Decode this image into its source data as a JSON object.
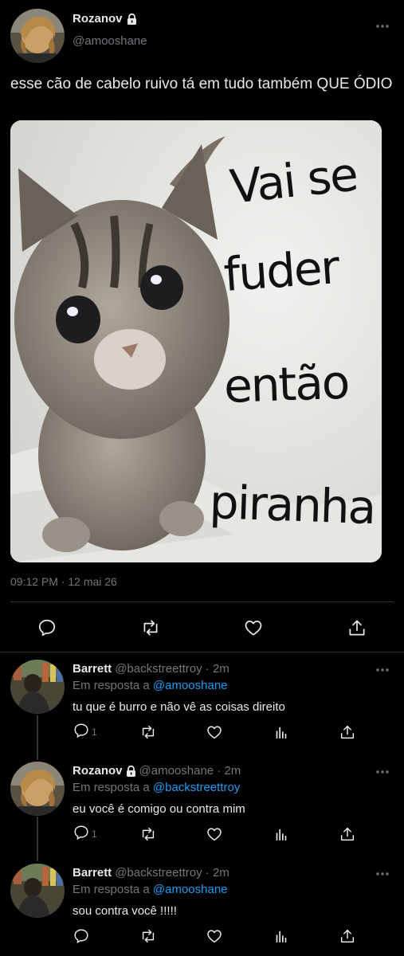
{
  "main_tweet": {
    "display_name": "Rozanov",
    "handle": "@amooshane",
    "text": "esse cão de cabelo ruivo tá em tudo também QUE ÓDIO",
    "image": {
      "meme_lines": [
        "Vai se",
        "fuder",
        "então",
        "piranha"
      ]
    },
    "timestamp": "09:12 PM · 12 mai 26",
    "actions": [
      "reply-icon",
      "retweet-icon",
      "like-icon",
      "share-icon"
    ]
  },
  "replies": [
    {
      "display_name": "Barrett",
      "handle_time": "@backstreettroy · 2m",
      "reply_prefix": "Em resposta a ",
      "reply_to": "@amooshane",
      "text": "tu que é burro e não vê as coisas direito",
      "reply_count": "1",
      "locked": false
    },
    {
      "display_name": "Rozanov",
      "handle_time": "@amooshane · 2m",
      "reply_prefix": "Em resposta a ",
      "reply_to": "@backstreettroy",
      "text": "eu você é comigo ou contra mim",
      "reply_count": "1",
      "locked": true
    },
    {
      "display_name": "Barrett",
      "handle_time": "@backstreettroy · 2m",
      "reply_prefix": "Em resposta a ",
      "reply_to": "@amooshane",
      "text": "sou contra você !!!!!",
      "reply_count": "",
      "locked": false
    }
  ],
  "colors": {
    "background": "#000000",
    "text": "#e7e9ea",
    "muted": "#71767b",
    "link": "#1d9bf0",
    "divider": "#2f3336"
  }
}
